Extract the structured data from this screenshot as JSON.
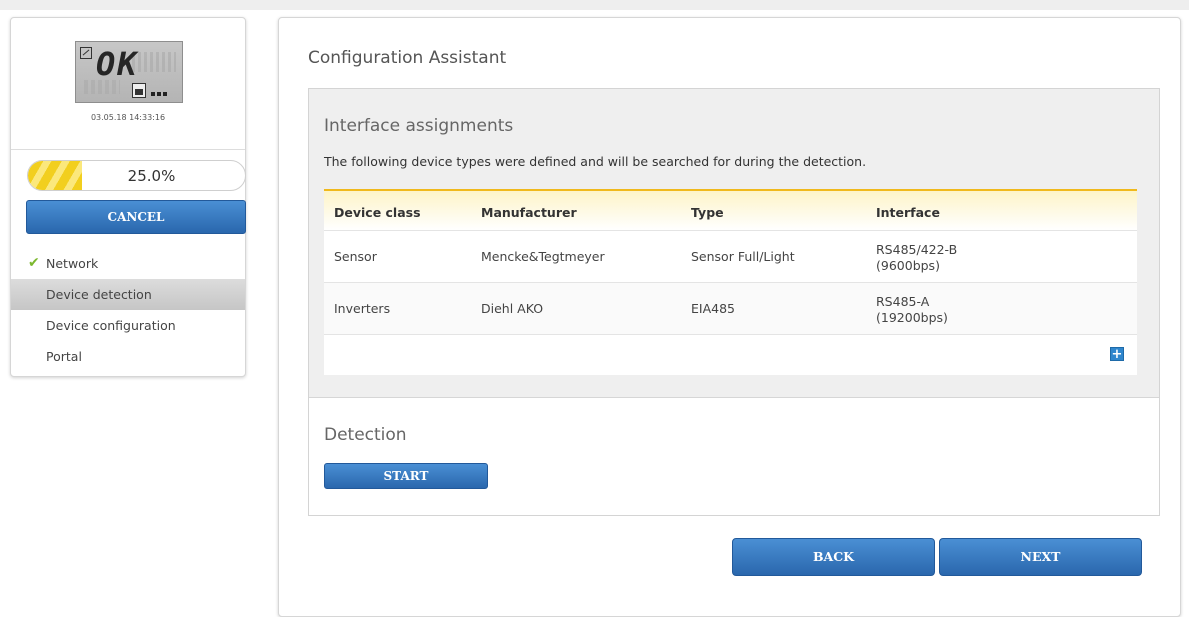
{
  "device_display": {
    "state_text": "OK",
    "datetime": "03.05.18 14:33:16"
  },
  "progress": {
    "percent": 25,
    "label": "25.0%"
  },
  "sidebar": {
    "cancel_label": "CANCEL",
    "items": [
      {
        "label": "Network",
        "state": "completed"
      },
      {
        "label": "Device detection",
        "state": "active"
      },
      {
        "label": "Device configuration",
        "state": "pending"
      },
      {
        "label": "Portal",
        "state": "pending"
      }
    ]
  },
  "main": {
    "title": "Configuration Assistant",
    "interface_assignments": {
      "title": "Interface assignments",
      "description": "The following device types were defined and will be searched for during the detection.",
      "columns": [
        "Device class",
        "Manufacturer",
        "Type",
        "Interface"
      ],
      "rows": [
        {
          "device_class": "Sensor",
          "manufacturer": "Mencke&Tegtmeyer",
          "type": "Sensor Full/Light",
          "interface_line1": "RS485/422-B",
          "interface_line2": "(9600bps)"
        },
        {
          "device_class": "Inverters",
          "manufacturer": "Diehl AKO",
          "type": "EIA485",
          "interface_line1": "RS485-A",
          "interface_line2": "(19200bps)"
        }
      ],
      "add_label": "+"
    },
    "detection": {
      "title": "Detection",
      "start_label": "START"
    },
    "back_label": "BACK",
    "next_label": "NEXT"
  },
  "colors": {
    "primary_button": "#2f78c4",
    "progress_fill": "#f2cf1e",
    "check_green": "#7cb82f",
    "table_header_accent": "#f0b91c"
  }
}
